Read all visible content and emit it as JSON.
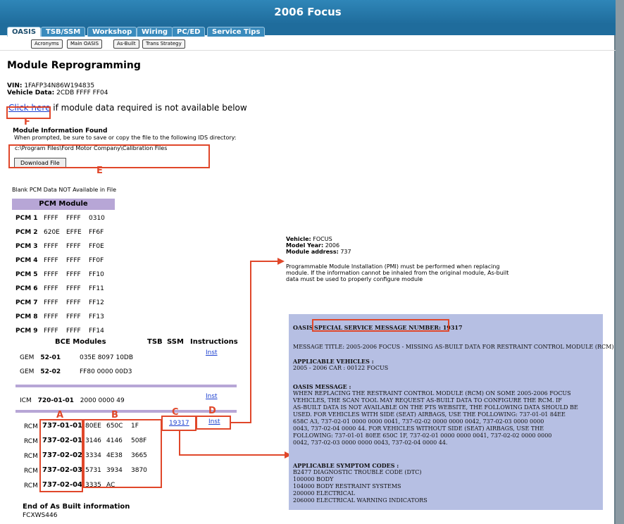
{
  "window": {
    "title": "2006 Focus"
  },
  "tabs": [
    "OASIS",
    "TSB/SSM",
    "Workshop",
    "Wiring",
    "PC/ED",
    "Service Tips"
  ],
  "subnav": [
    "Acronyms",
    "Main OASIS",
    "As-Built",
    "Trans Strategy"
  ],
  "page": {
    "heading": "Module Reprogramming",
    "vin_label": "VIN:",
    "vin": "1FAFP34N86W194835",
    "vehicle_data_label": "Vehicle Data:",
    "vehicle_data": "2CDB  FFFF  FF04",
    "click_here": "Click here",
    "click_here_rest": " if module data required is not available below",
    "module_info_heading": "Module Information Found",
    "module_info_text": "When prompted, be sure to save or copy the file to the following IDS directory:",
    "directory": "c:\\Program Files\\Ford Motor Company\\Calibration Files",
    "download_label": "Download File",
    "blank_pcm": "Blank PCM Data NOT Available in File",
    "end_label": "End of As Built information",
    "footer_code": "FCXWS446"
  },
  "callouts": {
    "a": "A",
    "b": "B",
    "c": "C",
    "d": "D",
    "e": "E",
    "f": "F"
  },
  "pcm": {
    "header": "PCM Module",
    "rows": [
      {
        "label": "PCM 1",
        "v": [
          "FFFF",
          "FFFF",
          "0310"
        ]
      },
      {
        "label": "PCM 2",
        "v": [
          "620E",
          "EFFE",
          "FF6F"
        ]
      },
      {
        "label": "PCM 3",
        "v": [
          "FFFF",
          "FFFF",
          "FF0E"
        ]
      },
      {
        "label": "PCM 4",
        "v": [
          "FFFF",
          "FFFF",
          "FF0F"
        ]
      },
      {
        "label": "PCM 5",
        "v": [
          "FFFF",
          "FFFF",
          "FF10"
        ]
      },
      {
        "label": "PCM 6",
        "v": [
          "FFFF",
          "FFFF",
          "FF11"
        ]
      },
      {
        "label": "PCM 7",
        "v": [
          "FFFF",
          "FFFF",
          "FF12"
        ]
      },
      {
        "label": "PCM 8",
        "v": [
          "FFFF",
          "FFFF",
          "FF13"
        ]
      },
      {
        "label": "PCM 9",
        "v": [
          "FFFF",
          "FFFF",
          "FF14"
        ]
      }
    ]
  },
  "bce": {
    "header": "BCE Modules",
    "col_tsb": "TSB",
    "col_ssm": "SSM",
    "col_instr": "Instructions",
    "rows": [
      {
        "mod": "GEM",
        "part": "52-01",
        "vals": "035E  8097  10DB",
        "inst": "Inst"
      },
      {
        "mod": "GEM",
        "part": "52-02",
        "vals": "FF80  0000  00D3",
        "inst": ""
      }
    ]
  },
  "icm": {
    "mod": "ICM",
    "part": "720-01-01",
    "vals": "2000  0000  49",
    "inst": "Inst"
  },
  "rcm": {
    "ssm_link": "19317",
    "inst": "Inst",
    "rows": [
      {
        "mod": "RCM",
        "part": "737-01-01",
        "v": [
          "80EE",
          "650C",
          "1F"
        ]
      },
      {
        "mod": "RCM",
        "part": "737-02-01",
        "v": [
          "3146",
          "4146",
          "508F"
        ]
      },
      {
        "mod": "RCM",
        "part": "737-02-02",
        "v": [
          "3334",
          "4E38",
          "3665"
        ]
      },
      {
        "mod": "RCM",
        "part": "737-02-03",
        "v": [
          "5731",
          "3934",
          "3870"
        ]
      },
      {
        "mod": "RCM",
        "part": "737-02-04",
        "v": [
          "3335",
          "AC",
          ""
        ]
      }
    ]
  },
  "vehicle_info": {
    "vehicle_label": "Vehicle:",
    "vehicle": "FOCUS",
    "year_label": "Model Year:",
    "year": "2006",
    "address_label": "Module address:",
    "address": "737",
    "pmi_1": "Programmable Module Installation (PMI) must be performed when replacing",
    "pmi_2": "module. If the information cannot be inhaled from the original module, As-built",
    "pmi_3": "data must be used to properly configure module"
  },
  "ssm": {
    "oasis": "OASIS",
    "number_label": "SPECIAL SERVICE MESSAGE NUMBER: 19317",
    "title": "MESSAGE TITLE: 2005-2006 FOCUS - MISSING AS-BUILT DATA FOR RESTRAINT CONTROL MODULE (RCM)",
    "applicable_vehicles": "APPLICABLE VEHICLES :",
    "vehicles_line": "2005 - 2006 CAR : 00122 FOCUS",
    "oasis_message": "OASIS MESSAGE :",
    "msg": [
      "WHEN REPLACING THE RESTRAINT CONTROL MODULE (RCM) ON SOME 2005-2006 FOCUS",
      "VEHICLES, THE SCAN TOOL MAY REQUEST AS-BUILT DATA TO CONFIGURE THE RCM. IF",
      "AS-BUILT DATA IS NOT AVAILABLE ON THE PTS WEBSITE, THE FOLLOWING DATA SHOULD BE",
      "USED. FOR VEHICLES WITH SIDE (SEAT) AIRBAGS, USE THE FOLLOWING: 737-01-01 84EE",
      "658C A3, 737-02-01 0000 0000 0041, 737-02-02 0000 0000 0042, 737-02-03 0000 0000",
      "0043, 737-02-04 0000 44. FOR VEHICLES WITHOUT SIDE (SEAT) AIRBAGS, USE THE",
      "FOLLOWING: 737-01-01 80EE 650C 1F, 737-02-01 0000 0000 0041, 737-02-02 0000 0000",
      "0042, 737-02-03 0000 0000 0043, 737-02-04 0000 44."
    ],
    "symptom_heading": "APPLICABLE SYMPTOM CODES :",
    "symptoms": [
      "B2477 DIAGNOSTIC TROUBLE CODE (DTC)",
      "100000 BODY",
      "104000 BODY RESTRAINT SYSTEMS",
      "200000 ELECTRICAL",
      "206000 ELECTRICAL WARNING INDICATORS"
    ]
  },
  "colors": {
    "annotation": "#e0472a",
    "table_header": "#b7a6d6",
    "ssm_bg": "#b6bfe3",
    "titlebar": "#1f6c9c"
  }
}
